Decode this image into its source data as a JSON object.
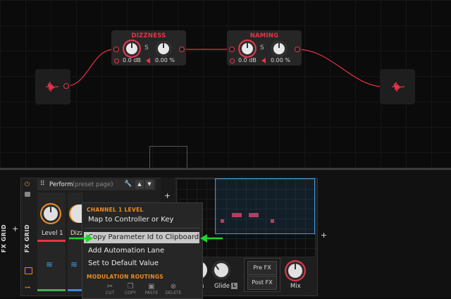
{
  "canvas": {
    "nodes": [
      {
        "title": "DIZZNESS",
        "value_left": "0.0 dB",
        "s_label": "S",
        "value_right": "0.00 %"
      },
      {
        "title": "NAMING",
        "value_left": "0.0 dB",
        "s_label": "S",
        "value_right": "0.00 %"
      }
    ]
  },
  "sidebar": {
    "fx_grid_label": "FX GRID",
    "fx_grid_inner_label": "FX GRID",
    "plus": "+"
  },
  "device": {
    "preset_title": "Perform",
    "preset_subtitle": "(preset page)",
    "knob1_label": "Level 1",
    "knob2_label": "Dizz",
    "right_plus": "+",
    "add_plus": "+"
  },
  "context_menu": {
    "header1": "CHANNEL 1 LEVEL",
    "items": [
      "Map to Controller or Key",
      "Copy Parameter Id to Clipboard",
      "Add Automation Lane",
      "Set to Default Value"
    ],
    "header2": "MODULATION ROUTINGS",
    "tools": [
      "CUT",
      "COPY",
      "PASTE",
      "DELETE"
    ]
  },
  "right_controls": {
    "partial_label": "n",
    "glide_label": "Glide",
    "glide_badge": "L",
    "pre_fx": "Pre FX",
    "post_fx": "Post FX",
    "mix_label": "Mix"
  },
  "colors": {
    "accent_red": "#e8334a",
    "accent_orange": "#f08b20",
    "highlight_blue": "#3aa0e8",
    "arrow_green": "#22d32b"
  }
}
